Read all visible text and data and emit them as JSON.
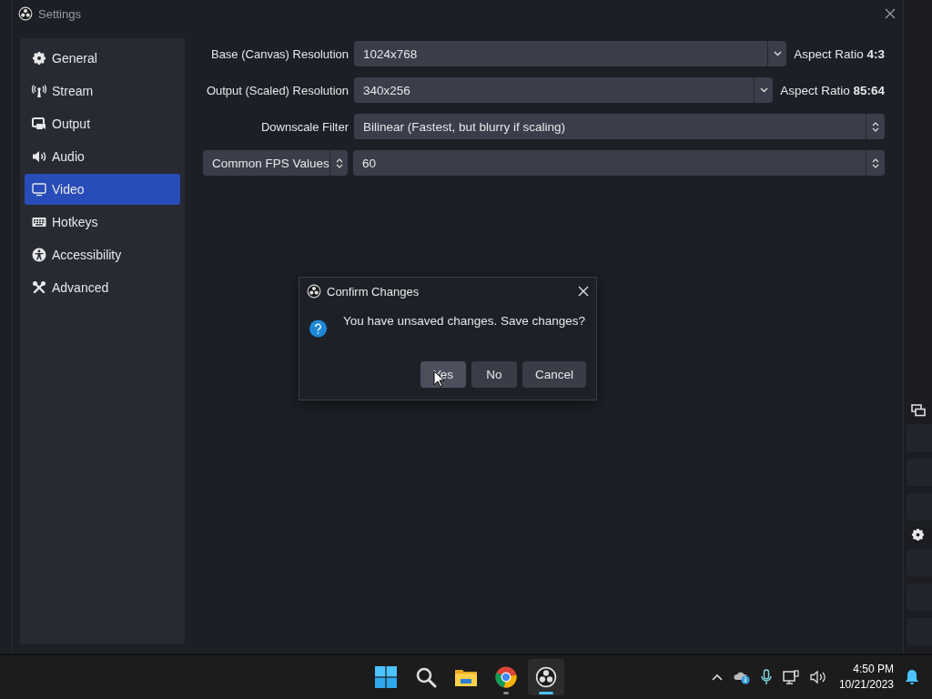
{
  "window": {
    "title": "Settings"
  },
  "sidebar": {
    "items": [
      {
        "label": "General",
        "selected": false
      },
      {
        "label": "Stream",
        "selected": false
      },
      {
        "label": "Output",
        "selected": false
      },
      {
        "label": "Audio",
        "selected": false
      },
      {
        "label": "Video",
        "selected": true
      },
      {
        "label": "Hotkeys",
        "selected": false
      },
      {
        "label": "Accessibility",
        "selected": false
      },
      {
        "label": "Advanced",
        "selected": false
      }
    ]
  },
  "video_settings": [
    {
      "kind": "combo",
      "label": "Base (Canvas) Resolution",
      "value": "1024x768",
      "aspect": "Aspect Ratio **4:3**"
    },
    {
      "kind": "combo",
      "label": "Output (Scaled) Resolution",
      "value": "340x256",
      "aspect": "Aspect Ratio **85:64**"
    },
    {
      "kind": "select",
      "label": "Downscale Filter",
      "value": "Bilinear (Fastest, but blurry if scaling)"
    },
    {
      "kind": "select_pair",
      "label": "Common FPS Values",
      "value": "60"
    }
  ],
  "dialog": {
    "title": "Confirm Changes",
    "message": "You have unsaved changes. Save changes?",
    "buttons": [
      {
        "label": "Yes",
        "hovered": true
      },
      {
        "label": "No",
        "hovered": false
      },
      {
        "label": "Cancel",
        "hovered": false
      }
    ]
  },
  "taskbar": {
    "apps": [
      {
        "kind": "start",
        "running": false,
        "selected": false
      },
      {
        "kind": "search",
        "running": false,
        "selected": false
      },
      {
        "kind": "files",
        "running": false,
        "selected": false
      },
      {
        "kind": "browser",
        "running": true,
        "selected": false
      },
      {
        "kind": "obs",
        "running": true,
        "selected": true
      }
    ],
    "time": "4:50 PM",
    "date": "10/21/2023"
  }
}
